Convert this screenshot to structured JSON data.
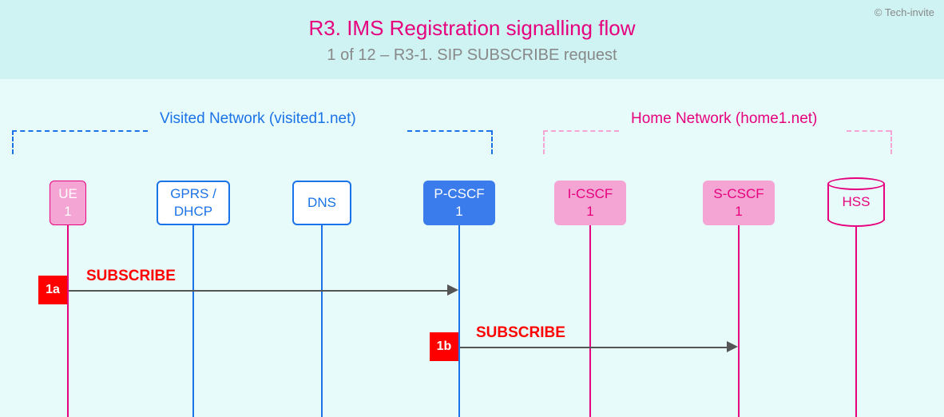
{
  "copyright": "© Tech-invite",
  "title": "R3. IMS Registration signalling flow",
  "subtitle": "1 of 12 – R3-1. SIP SUBSCRIBE request",
  "networks": {
    "visited": {
      "label": "Visited Network (visited1.net)",
      "color": "#1a73e8"
    },
    "home": {
      "label": "Home Network (home1.net)",
      "color": "#e6007e"
    }
  },
  "nodes": {
    "ue": "UE\n1",
    "gprs": "GPRS /\nDHCP",
    "dns": "DNS",
    "pcscf": "P-CSCF\n1",
    "icscf": "I-CSCF\n1",
    "scscf": "S-CSCF\n1",
    "hss": "HSS"
  },
  "messages": {
    "m1a": {
      "id": "1a",
      "label": "SUBSCRIBE"
    },
    "m1b": {
      "id": "1b",
      "label": "SUBSCRIBE"
    }
  }
}
